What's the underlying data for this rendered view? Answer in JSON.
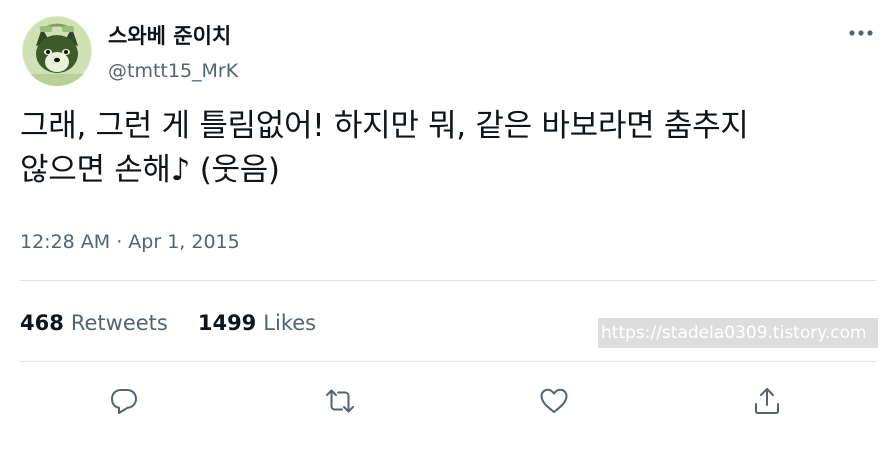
{
  "author": {
    "display_name": "스와베 준이치",
    "handle": "@tmtt15_MrK",
    "avatar_icon": "shiba-dog-avatar"
  },
  "more_icon": "more-horizontal-icon",
  "tweet": {
    "text": "그래, 그런 게 틀림없어! 하지만 뭐, 같은 바보라면 춤추지\n않으면 손해♪ (웃음)",
    "timestamp": "12:28 AM · Apr 1, 2015"
  },
  "stats": {
    "retweets_count": "468",
    "retweets_label": "Retweets",
    "likes_count": "1499",
    "likes_label": "Likes"
  },
  "watermark": "https://stadela0309.tistory.com",
  "actions": [
    {
      "name": "reply",
      "icon": "reply-icon"
    },
    {
      "name": "retweet",
      "icon": "retweet-icon"
    },
    {
      "name": "like",
      "icon": "heart-icon"
    },
    {
      "name": "share",
      "icon": "share-icon"
    }
  ],
  "colors": {
    "text_primary": "#0f1419",
    "text_secondary": "#536471",
    "divider": "#dfe4e8"
  }
}
